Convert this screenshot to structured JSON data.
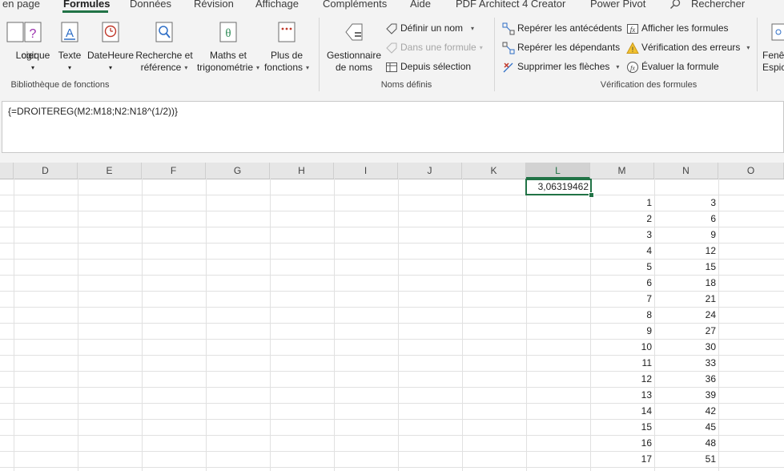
{
  "tabs": [
    {
      "label": "en page",
      "active": false
    },
    {
      "label": "Formules",
      "active": true
    },
    {
      "label": "Données",
      "active": false
    },
    {
      "label": "Révision",
      "active": false
    },
    {
      "label": "Affichage",
      "active": false
    },
    {
      "label": "Compléments",
      "active": false
    },
    {
      "label": "Aide",
      "active": false
    },
    {
      "label": "PDF Architect 4 Creator",
      "active": false
    },
    {
      "label": "Power Pivot",
      "active": false
    }
  ],
  "search": {
    "label": "Rechercher",
    "icon": "search-icon"
  },
  "ribbon": {
    "library": {
      "group_label": "Bibliothèque de fonctions",
      "buttons": [
        {
          "line1": "cier",
          "line2": "",
          "icon": "financial-icon"
        },
        {
          "line1": "Logique",
          "line2": "",
          "icon": "logical-icon"
        },
        {
          "line1": "Texte",
          "line2": "",
          "icon": "text-icon"
        },
        {
          "line1": "DateHeure",
          "line2": "",
          "icon": "clock-icon"
        },
        {
          "line1": "Recherche et",
          "line2": "référence",
          "icon": "lookup-icon"
        },
        {
          "line1": "Maths et",
          "line2": "trigonométrie",
          "icon": "math-icon"
        },
        {
          "line1": "Plus de",
          "line2": "fonctions",
          "icon": "more-functions-icon"
        }
      ]
    },
    "names": {
      "group_label": "Noms définis",
      "manager": {
        "line1": "Gestionnaire",
        "line2": "de noms",
        "icon": "name-manager-icon"
      },
      "define_name": "Définir un nom",
      "use_in_formula": "Dans une formule",
      "from_selection": "Depuis sélection"
    },
    "audit": {
      "group_label": "Vérification des formules",
      "trace_precedents": "Repérer les antécédents",
      "trace_dependents": "Repérer les dépendants",
      "remove_arrows": "Supprimer les flèches",
      "show_formulas": "Afficher les formules",
      "error_checking": "Vérification des erreurs",
      "evaluate_formula": "Évaluer la formule"
    },
    "window": {
      "line1": "Fenêt",
      "line2": "Espic"
    }
  },
  "formula": "{=DROITEREG(M2:M18;N2:N18^(1/2))}",
  "columns": [
    "D",
    "E",
    "F",
    "G",
    "H",
    "I",
    "J",
    "K",
    "L",
    "M",
    "N",
    "O"
  ],
  "selected_column": "L",
  "active_cell_value": "3,06319462",
  "rows": [
    {
      "m": "",
      "n": ""
    },
    {
      "m": "1",
      "n": "3"
    },
    {
      "m": "2",
      "n": "6"
    },
    {
      "m": "3",
      "n": "9"
    },
    {
      "m": "4",
      "n": "12"
    },
    {
      "m": "5",
      "n": "15"
    },
    {
      "m": "6",
      "n": "18"
    },
    {
      "m": "7",
      "n": "21"
    },
    {
      "m": "8",
      "n": "24"
    },
    {
      "m": "9",
      "n": "27"
    },
    {
      "m": "10",
      "n": "30"
    },
    {
      "m": "11",
      "n": "33"
    },
    {
      "m": "12",
      "n": "36"
    },
    {
      "m": "13",
      "n": "39"
    },
    {
      "m": "14",
      "n": "42"
    },
    {
      "m": "15",
      "n": "45"
    },
    {
      "m": "16",
      "n": "48"
    },
    {
      "m": "17",
      "n": "51"
    }
  ],
  "colors": {
    "accent": "#217346",
    "ribbon_bg": "#f3f3f3"
  }
}
